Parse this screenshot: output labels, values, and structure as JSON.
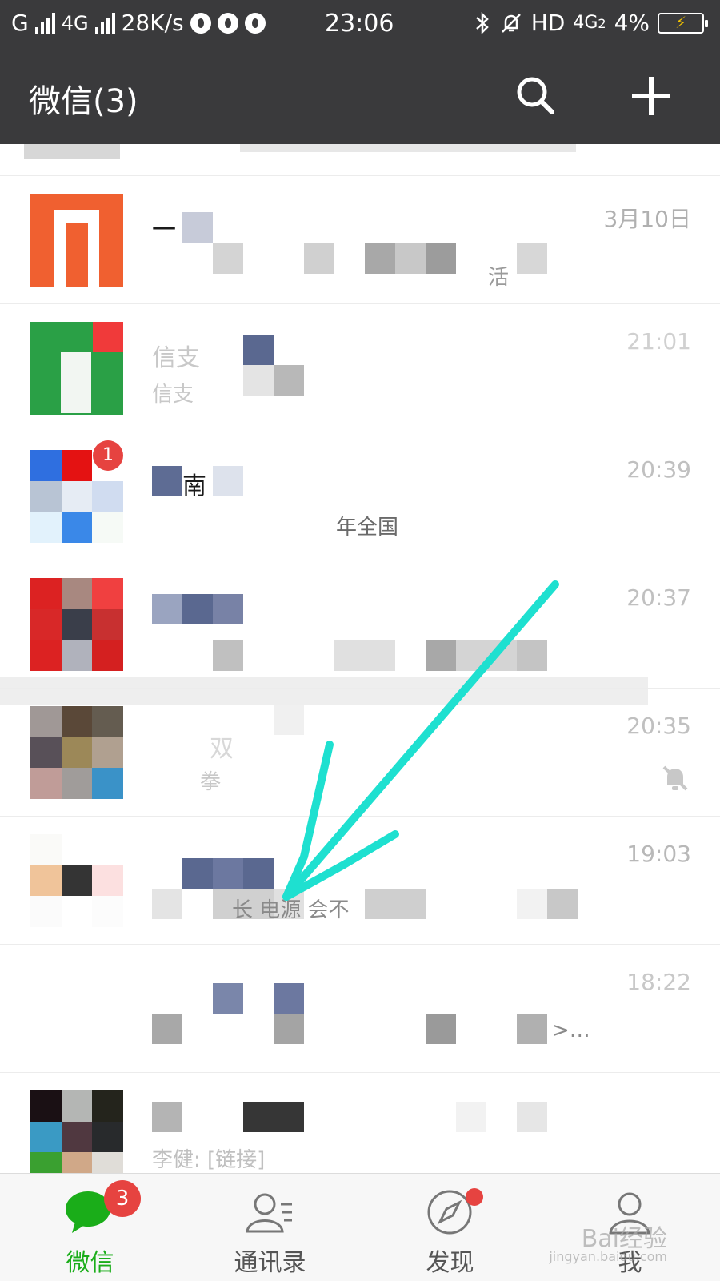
{
  "status_bar": {
    "carrier1": "G",
    "carrier2": "4G",
    "speed": "28K/s",
    "time": "23:06",
    "hd_label": "HD",
    "network": "4G",
    "network_sub": "2",
    "battery": "4%"
  },
  "header": {
    "title": "微信(3)",
    "search_icon": "search-icon",
    "add_icon": "plus-icon"
  },
  "chats": [
    {
      "name": "一",
      "preview": "活",
      "time": "3月10日"
    },
    {
      "name": "信支",
      "preview": "信支",
      "time": "21:01"
    },
    {
      "name": "南",
      "preview": "年全国",
      "time": "20:39",
      "badge": "1"
    },
    {
      "name": "",
      "preview": "",
      "time": "20:37"
    },
    {
      "name": "双",
      "preview": "拳",
      "time": "20:35",
      "muted": true
    },
    {
      "name": "",
      "preview": "长  电源  会不",
      "time": "19:03"
    },
    {
      "name": "",
      "preview": ">…",
      "time": "18:22"
    },
    {
      "name": "",
      "preview": "李健: [链接]",
      "time": ""
    }
  ],
  "bottom_nav": {
    "items": [
      {
        "label": "微信",
        "icon": "chat-bubble-icon",
        "badge": "3",
        "active": true
      },
      {
        "label": "通讯录",
        "icon": "contacts-icon"
      },
      {
        "label": "发现",
        "icon": "compass-icon",
        "dot": true
      },
      {
        "label": "我",
        "icon": "person-icon"
      }
    ]
  },
  "watermark": {
    "main": "Bai经验",
    "sub": "jingyan.baidu.com"
  },
  "colors": {
    "header_bg": "#3a3a3c",
    "active_green": "#1aad19",
    "badge_red": "#e64340",
    "arrow_cyan": "#1ee0d0"
  }
}
